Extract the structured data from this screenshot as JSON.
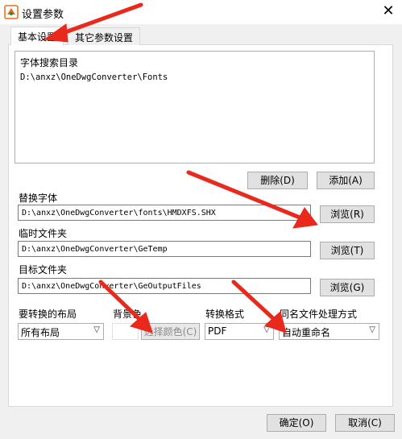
{
  "window": {
    "title": "设置参数",
    "close_glyph": "✕"
  },
  "tabs": [
    {
      "label": "基本设置"
    },
    {
      "label": "其它参数设置"
    }
  ],
  "font_dirs": {
    "header": "字体搜索目录",
    "items": [
      "D:\\anxz\\OneDwgConverter\\Fonts"
    ]
  },
  "buttons": {
    "delete": "删除(D)",
    "add": "添加(A)",
    "browse_r": "浏览(R)",
    "browse_t": "浏览(T)",
    "browse_g": "浏览(G)",
    "choose_color": "选择颜色(C)",
    "ok": "确定(O)",
    "cancel": "取消(C)"
  },
  "fields": {
    "replace_font": {
      "label": "替换字体",
      "value": "D:\\anxz\\OneDwgConverter\\fonts\\HMDXFS.SHX"
    },
    "temp_folder": {
      "label": "临时文件夹",
      "value": "D:\\anxz\\OneDwgConverter\\GeTemp"
    },
    "target_folder": {
      "label": "目标文件夹",
      "value": "D:\\anxz\\OneDwgConverter\\GeOutputFiles"
    }
  },
  "options": {
    "layout": {
      "label": "要转换的布局",
      "value": "所有布局"
    },
    "background": {
      "label": "背景色"
    },
    "format": {
      "label": "转换格式",
      "value": "PDF"
    },
    "same_name": {
      "label": "同名文件处理方式",
      "value": "自动重命名"
    }
  },
  "colors": {
    "arrow": "#e8291c",
    "accent_bar": "#0078d7"
  }
}
